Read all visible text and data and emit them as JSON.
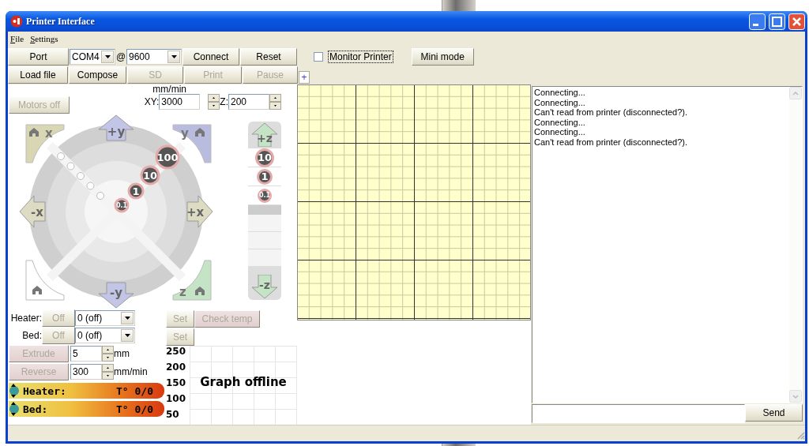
{
  "window": {
    "title": "Printer Interface"
  },
  "menu": [
    {
      "label": "File"
    },
    {
      "label": "Settings"
    }
  ],
  "toolbar": [
    [
      {
        "kind": "button",
        "label": "Port",
        "disabled": false
      },
      {
        "kind": "combo",
        "value": "COM4"
      },
      {
        "kind": "text",
        "label": "@"
      },
      {
        "kind": "combo",
        "value": "9600"
      },
      {
        "kind": "button",
        "label": "Connect",
        "disabled": false
      },
      {
        "kind": "button",
        "label": "Reset",
        "disabled": false
      },
      {
        "kind": "checkbox",
        "label": "Monitor Printer",
        "checked": false
      },
      {
        "kind": "button",
        "label": "Mini mode",
        "disabled": false
      }
    ],
    [
      {
        "kind": "button",
        "label": "Load file",
        "disabled": false
      },
      {
        "kind": "button",
        "label": "Compose",
        "disabled": false
      },
      {
        "kind": "button",
        "label": "SD",
        "disabled": true
      },
      {
        "kind": "button",
        "label": "Print",
        "disabled": true
      },
      {
        "kind": "button",
        "label": "Pause",
        "disabled": true
      },
      {
        "kind": "tab",
        "label": "+"
      }
    ]
  ],
  "motors_button": {
    "label": "Motors off",
    "disabled": true
  },
  "feedrate": {
    "unit": "mm/min",
    "xy_label": "XY:",
    "xy_value": "3000",
    "z_label": "Z:",
    "z_value": "200"
  },
  "xy_jog": {
    "home_x": "x",
    "home_y": "y",
    "home_z": "z",
    "plus_y": "+y",
    "minus_x": "-x",
    "plus_x": "+x",
    "minus_y": "-y",
    "steps": [
      "100",
      "10",
      "1",
      "0.1"
    ]
  },
  "z_jog": {
    "up": "+z",
    "steps": [
      "10",
      "1",
      "0.1"
    ],
    "down": "-z"
  },
  "temperature": [
    {
      "label": "Heater:",
      "button": "Off",
      "disabled": true,
      "value": "0 (off)",
      "set": "Set"
    },
    {
      "label": "Bed:",
      "button": "Off",
      "disabled": true,
      "value": "0 (off)",
      "set": "Set"
    }
  ],
  "check_temp": {
    "label": "Check temp",
    "disabled": true
  },
  "extrude": [
    {
      "button": "Extrude",
      "disabled": true,
      "value": "5",
      "unit": "mm"
    },
    {
      "button": "Reverse",
      "disabled": true,
      "value": "300",
      "unit": "mm/min"
    }
  ],
  "gauges": [
    {
      "label": "Heater:",
      "reading": "T° 0/0"
    },
    {
      "label": "Bed:",
      "reading": "T° 0/0"
    }
  ],
  "graph": {
    "y_labels": [
      "250",
      "200",
      "150",
      "100",
      "50"
    ],
    "message": "Graph offline"
  },
  "log": {
    "lines": [
      "Connecting...",
      "Connecting...",
      "Can't read from printer (disconnected?).",
      "Connecting...",
      "Connecting...",
      "Can't read from printer (disconnected?)."
    ]
  },
  "command": {
    "button": "Send"
  }
}
